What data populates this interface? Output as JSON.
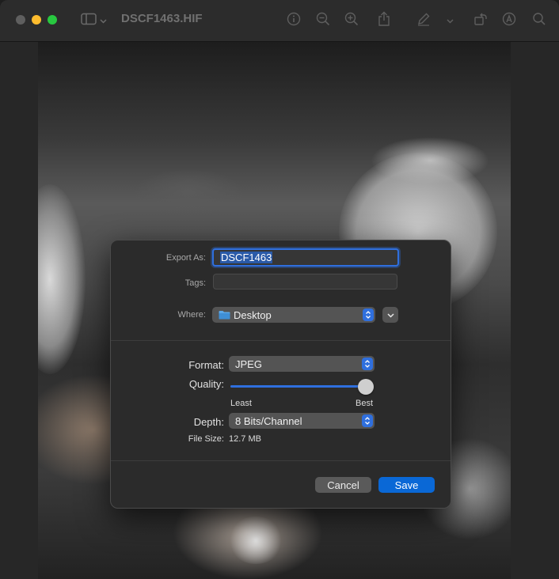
{
  "window": {
    "title": "DSCF1463.HIF"
  },
  "toolbar": {
    "icons": [
      "sidebar-icon",
      "chevron-down-icon",
      "info-icon",
      "zoom-out-icon",
      "zoom-in-icon",
      "share-icon",
      "markup-icon",
      "chevron-down-icon",
      "rotate-icon",
      "person-icon",
      "search-icon"
    ]
  },
  "dialog": {
    "export_as_label": "Export As:",
    "export_as_value": "DSCF1463",
    "tags_label": "Tags:",
    "tags_value": "",
    "where_label": "Where:",
    "where_value": "Desktop",
    "format_label": "Format:",
    "format_value": "JPEG",
    "quality_label": "Quality:",
    "quality_level": 1.0,
    "quality_min_label": "Least",
    "quality_max_label": "Best",
    "depth_label": "Depth:",
    "depth_value": "8 Bits/Channel",
    "file_size_label": "File Size:",
    "file_size_value": "12.7 MB",
    "cancel_label": "Cancel",
    "save_label": "Save"
  },
  "colors": {
    "accent": "#2f6fde",
    "save_button": "#0a68d6",
    "min": "#febc2e",
    "max": "#28c840"
  }
}
